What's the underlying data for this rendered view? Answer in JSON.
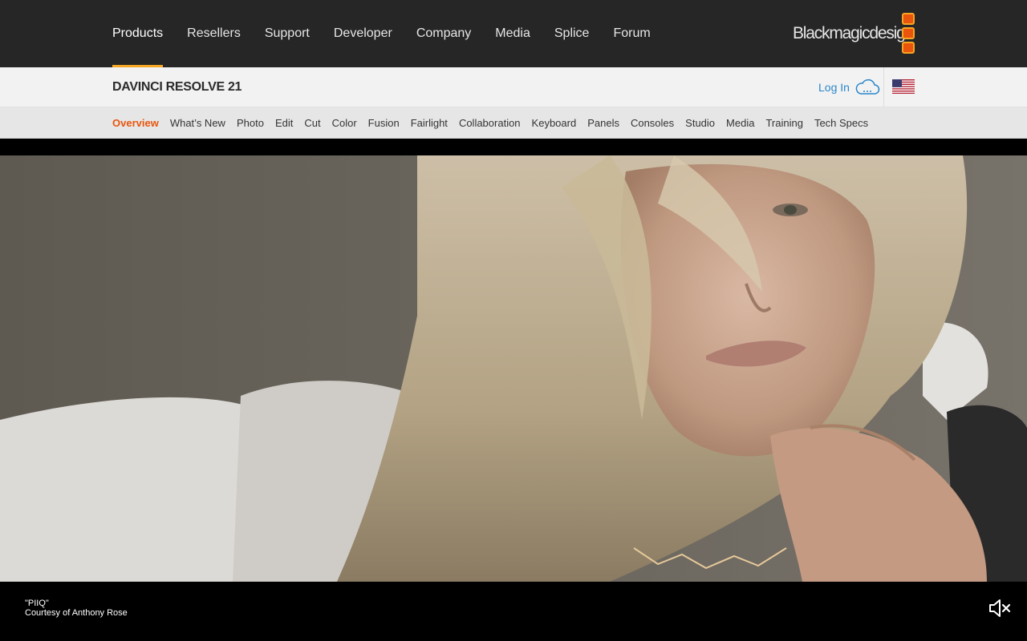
{
  "topnav": {
    "items": [
      {
        "label": "Products",
        "active": true
      },
      {
        "label": "Resellers"
      },
      {
        "label": "Support"
      },
      {
        "label": "Developer"
      },
      {
        "label": "Company"
      },
      {
        "label": "Media"
      },
      {
        "label": "Splice"
      },
      {
        "label": "Forum"
      }
    ],
    "logo_text": "Blackmagicdesign"
  },
  "product_bar": {
    "title": "DAVINCI RESOLVE 21",
    "login_label": "Log In",
    "cloud_icon": "cloud-icon",
    "flag_icon": "us-flag-icon"
  },
  "subnav": {
    "items": [
      {
        "label": "Overview",
        "active": true
      },
      {
        "label": "What’s New"
      },
      {
        "label": "Photo"
      },
      {
        "label": "Edit"
      },
      {
        "label": "Cut"
      },
      {
        "label": "Color"
      },
      {
        "label": "Fusion"
      },
      {
        "label": "Fairlight"
      },
      {
        "label": "Collaboration"
      },
      {
        "label": "Keyboard"
      },
      {
        "label": "Panels"
      },
      {
        "label": "Consoles"
      },
      {
        "label": "Studio"
      },
      {
        "label": "Media"
      },
      {
        "label": "Training"
      },
      {
        "label": "Tech Specs"
      }
    ]
  },
  "hero": {
    "caption_title": "\"PIIQ\"",
    "caption_credit": "Courtesy of Anthony Rose",
    "mute_icon": "speaker-muted-icon"
  },
  "colors": {
    "accent_orange": "#e9550c",
    "tab_underline": "#f5a623",
    "login_blue": "#2a86c9",
    "nav_bg": "#262626"
  }
}
